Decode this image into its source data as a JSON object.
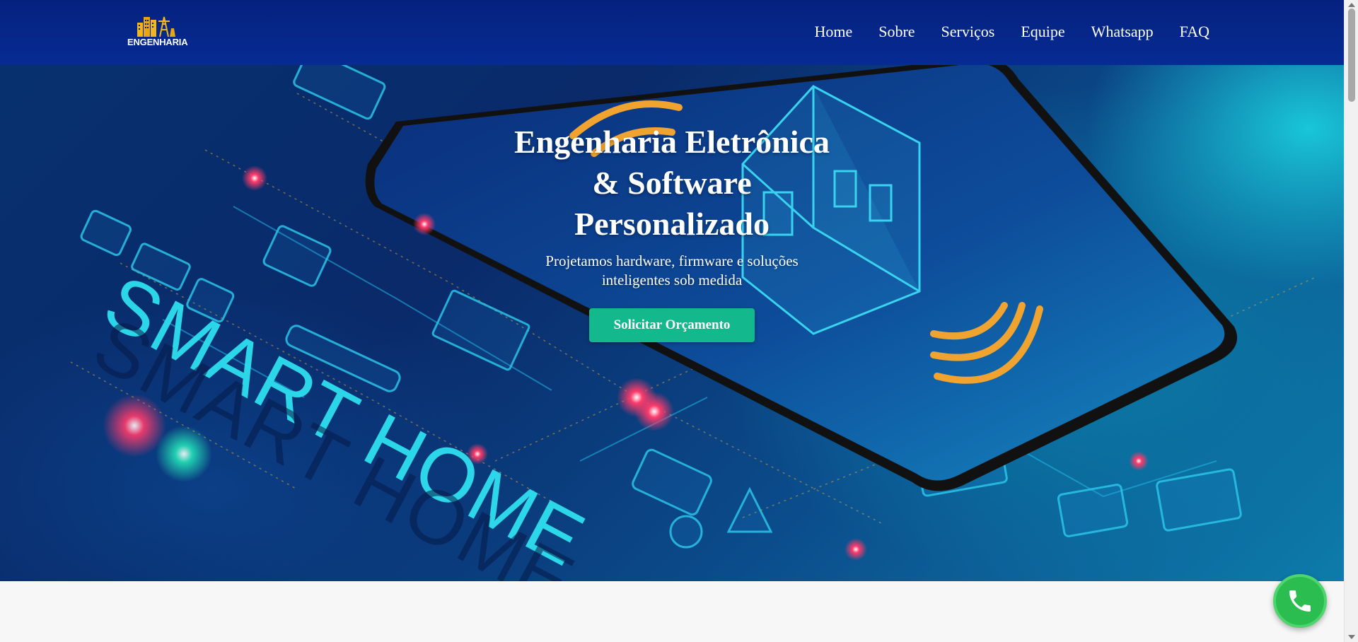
{
  "brand": {
    "logo_text": "ENGENHARIA",
    "accent_color": "#F2B51B"
  },
  "nav": {
    "items": [
      {
        "label": "Home"
      },
      {
        "label": "Sobre"
      },
      {
        "label": "Serviços"
      },
      {
        "label": "Equipe"
      },
      {
        "label": "Whatsapp"
      },
      {
        "label": "FAQ"
      }
    ]
  },
  "hero": {
    "title_line1": "Engenharia Eletrônica",
    "title_line2": "& Software",
    "title_line3": "Personalizado",
    "subtitle": "Projetamos hardware, firmware e soluções inteligentes sob medida",
    "cta_label": "Solicitar Orçamento",
    "cta_color": "#13B98D",
    "background_art_text": "SMART HOME"
  },
  "whatsapp_float": {
    "icon": "phone-icon",
    "color": "#2BBD4F"
  },
  "colors": {
    "navbar": "#05217F",
    "text": "#FFFFFF",
    "page_bg": "#F7F7F7"
  }
}
